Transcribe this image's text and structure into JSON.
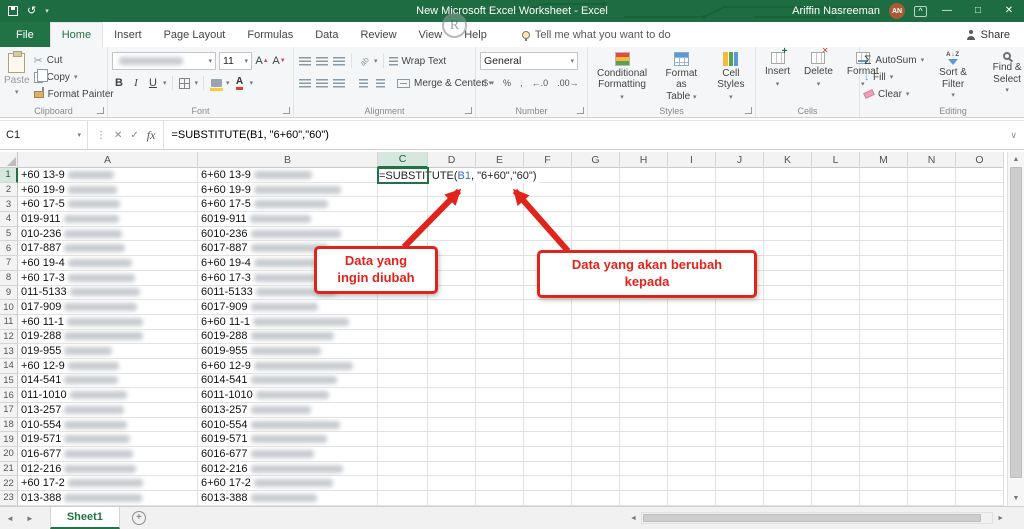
{
  "colors": {
    "excel_green": "#217346",
    "titlebar_green": "#1E6C41",
    "annotation_red": "#E0241B",
    "formula_ref_blue": "#3E65CE"
  },
  "titlebar": {
    "title": "New Microsoft Excel Worksheet - Excel",
    "user_name": "Ariffin Nasreeman",
    "avatar_initials": "AN"
  },
  "watermark_letter": "R",
  "tabs": [
    {
      "label": "File",
      "active": false
    },
    {
      "label": "Home",
      "active": true
    },
    {
      "label": "Insert",
      "active": false
    },
    {
      "label": "Page Layout",
      "active": false
    },
    {
      "label": "Formulas",
      "active": false
    },
    {
      "label": "Data",
      "active": false
    },
    {
      "label": "Review",
      "active": false
    },
    {
      "label": "View",
      "active": false
    },
    {
      "label": "Help",
      "active": false
    }
  ],
  "tell_me": "Tell me what you want to do",
  "share_label": "Share",
  "ribbon": {
    "clipboard": {
      "label": "Clipboard",
      "paste": "Paste",
      "cut": "Cut",
      "copy": "Copy",
      "format_painter": "Format Painter"
    },
    "font": {
      "label": "Font",
      "size": "11"
    },
    "alignment": {
      "label": "Alignment",
      "wrap_text": "Wrap Text",
      "merge_center": "Merge & Center"
    },
    "number": {
      "label": "Number",
      "format": "General"
    },
    "styles": {
      "label": "Styles",
      "buttons": [
        {
          "line1": "Conditional",
          "line2": "Formatting"
        },
        {
          "line1": "Format as",
          "line2": "Table"
        },
        {
          "line1": "Cell",
          "line2": "Styles"
        }
      ]
    },
    "cells": {
      "label": "Cells",
      "buttons": [
        "Insert",
        "Delete",
        "Format"
      ]
    },
    "editing": {
      "label": "Editing",
      "autosum": "AutoSum",
      "fill": "Fill",
      "clear": "Clear",
      "sort_filter": "Sort & Filter",
      "find_select": "Find & Select"
    }
  },
  "formula_bar": {
    "name_box": "C1",
    "formula": "=SUBSTITUTE(B1, \"6+60\",\"60\")"
  },
  "grid": {
    "columns": [
      "A",
      "B",
      "C",
      "D",
      "E",
      "F",
      "G",
      "H",
      "I",
      "J",
      "K",
      "L",
      "M",
      "N",
      "O"
    ],
    "active_column": "C",
    "active_row": 1,
    "active_cell_formula": {
      "prefix": "=SUBSTITUTE(",
      "ref": "B1",
      "suffix": ", \"6+60\",\"60\")"
    },
    "rows": [
      {
        "n": 1,
        "a": "+60 13-9",
        "b": "6+60 13-9"
      },
      {
        "n": 2,
        "a": "+60 19-9",
        "b": "6+60 19-9"
      },
      {
        "n": 3,
        "a": "+60 17-5",
        "b": "6+60 17-5"
      },
      {
        "n": 4,
        "a": "019-911",
        "b": "6019-911"
      },
      {
        "n": 5,
        "a": "010-236",
        "b": "6010-236"
      },
      {
        "n": 6,
        "a": "017-887",
        "b": "6017-887"
      },
      {
        "n": 7,
        "a": "+60 19-4",
        "b": "6+60 19-4"
      },
      {
        "n": 8,
        "a": "+60 17-3",
        "b": "6+60 17-3"
      },
      {
        "n": 9,
        "a": "011-5133",
        "b": "6011-5133"
      },
      {
        "n": 10,
        "a": "017-909",
        "b": "6017-909"
      },
      {
        "n": 11,
        "a": "+60 11-1",
        "b": "6+60 11-1"
      },
      {
        "n": 12,
        "a": "019-288",
        "b": "6019-288"
      },
      {
        "n": 13,
        "a": "019-955",
        "b": "6019-955"
      },
      {
        "n": 14,
        "a": "+60 12-9",
        "b": "6+60 12-9"
      },
      {
        "n": 15,
        "a": "014-541",
        "b": "6014-541"
      },
      {
        "n": 16,
        "a": "011-1010",
        "b": "6011-1010"
      },
      {
        "n": 17,
        "a": "013-257",
        "b": "6013-257"
      },
      {
        "n": 18,
        "a": "010-554",
        "b": "6010-554"
      },
      {
        "n": 19,
        "a": "019-571",
        "b": "6019-571"
      },
      {
        "n": 20,
        "a": "016-677",
        "b": "6016-677"
      },
      {
        "n": 21,
        "a": "012-216",
        "b": "6012-216"
      },
      {
        "n": 22,
        "a": "+60 17-2",
        "b": "6+60 17-2"
      },
      {
        "n": 23,
        "a": "013-388",
        "b": "6013-388"
      }
    ]
  },
  "annotations": [
    {
      "line1": "Data yang",
      "line2": "ingin diubah"
    },
    {
      "line1": "Data yang akan berubah",
      "line2": "kepada"
    }
  ],
  "sheet_bar": {
    "active_sheet": "Sheet1"
  }
}
